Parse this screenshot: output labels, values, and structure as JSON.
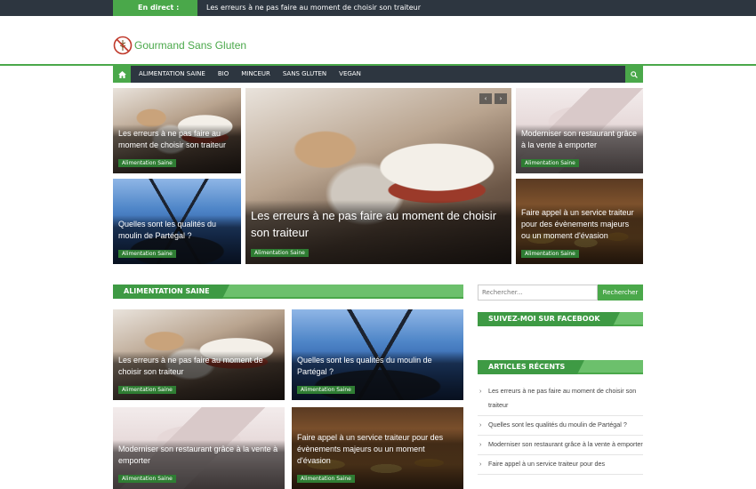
{
  "ticker": {
    "label": "En direct :",
    "text": "Les erreurs à ne pas faire au moment de choisir son traiteur"
  },
  "brand": {
    "name": "Gourmand Sans Gluten"
  },
  "nav": {
    "items": [
      "ALIMENTATION SAINE",
      "BIO",
      "MINCEUR",
      "SANS GLUTEN",
      "VEGAN"
    ]
  },
  "featured": {
    "tiles": [
      {
        "title": "Les erreurs à ne pas faire au moment de choisir son traiteur",
        "category": "Alimentation Saine"
      },
      {
        "title": "Quelles sont les qualités du moulin de Partégal ?",
        "category": "Alimentation Saine"
      },
      {
        "title": "Les erreurs à ne pas faire au moment de choisir son traiteur",
        "category": "Alimentation Saine"
      },
      {
        "title": "Moderniser son restaurant grâce à la vente à emporter",
        "category": "Alimentation Saine"
      },
      {
        "title": "Faire appel à un service traiteur pour des évènements majeurs ou un moment d'évasion",
        "category": "Alimentation Saine"
      }
    ]
  },
  "section": {
    "title": "ALIMENTATION SAINE"
  },
  "posts": [
    {
      "title": "Les erreurs à ne pas faire au moment de choisir son traiteur",
      "category": "Alimentation Saine"
    },
    {
      "title": "Quelles sont les qualités du moulin de Partégal ?",
      "category": "Alimentation Saine"
    },
    {
      "title": "Moderniser son restaurant grâce à la vente à emporter",
      "category": "Alimentation Saine"
    },
    {
      "title": "Faire appel à un service traiteur pour des évènements majeurs ou un moment d'évasion",
      "category": "Alimentation Saine"
    }
  ],
  "sidebar": {
    "search_placeholder": "Rechercher...",
    "search_button": "Rechercher",
    "facebook_title": "SUIVEZ-MOI SUR FACEBOOK",
    "recent_title": "ARTICLES RÉCENTS",
    "recent": [
      "Les erreurs à ne pas faire au moment de choisir son traiteur",
      "Quelles sont les qualités du moulin de Partégal ?",
      "Moderniser son restaurant grâce à la vente à emporter",
      "Faire appel à un service traiteur pour des"
    ]
  },
  "colors": {
    "accent": "#4aa84a",
    "dark": "#2d3640"
  }
}
